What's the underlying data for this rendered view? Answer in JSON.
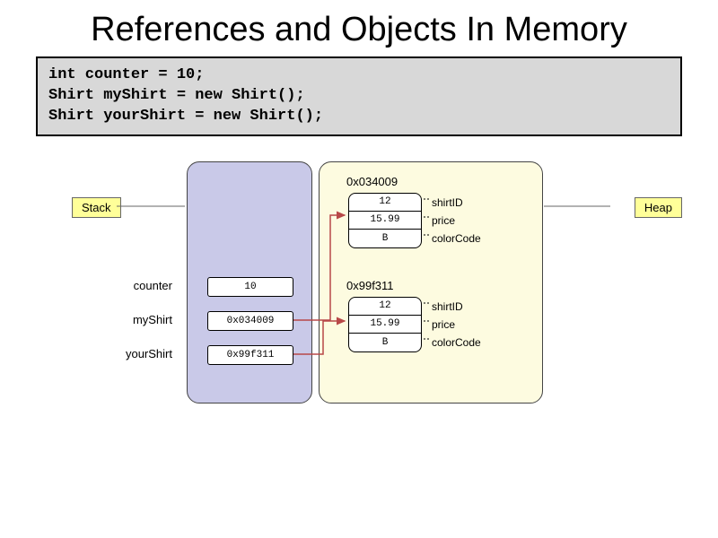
{
  "title": "References and Objects In Memory",
  "code": "int counter = 10;\nShirt myShirt = new Shirt();\nShirt yourShirt = new Shirt();",
  "labels": {
    "stack": "Stack",
    "heap": "Heap"
  },
  "stack_vars": [
    {
      "name": "counter",
      "value": "10"
    },
    {
      "name": "myShirt",
      "value": "0x034009"
    },
    {
      "name": "yourShirt",
      "value": "0x99f311"
    }
  ],
  "heap_objects": [
    {
      "address": "0x034009",
      "fields": [
        {
          "name": "shirtID",
          "value": "12"
        },
        {
          "name": "price",
          "value": "15.99"
        },
        {
          "name": "colorCode",
          "value": "B"
        }
      ]
    },
    {
      "address": "0x99f311",
      "fields": [
        {
          "name": "shirtID",
          "value": "12"
        },
        {
          "name": "price",
          "value": "15.99"
        },
        {
          "name": "colorCode",
          "value": "B"
        }
      ]
    }
  ],
  "colors": {
    "code_bg": "#d8d8d8",
    "stack_bg": "#c9c9e8",
    "heap_bg": "#fdfbe0",
    "label_bg": "#ffff99",
    "arrow": "#b84848"
  }
}
